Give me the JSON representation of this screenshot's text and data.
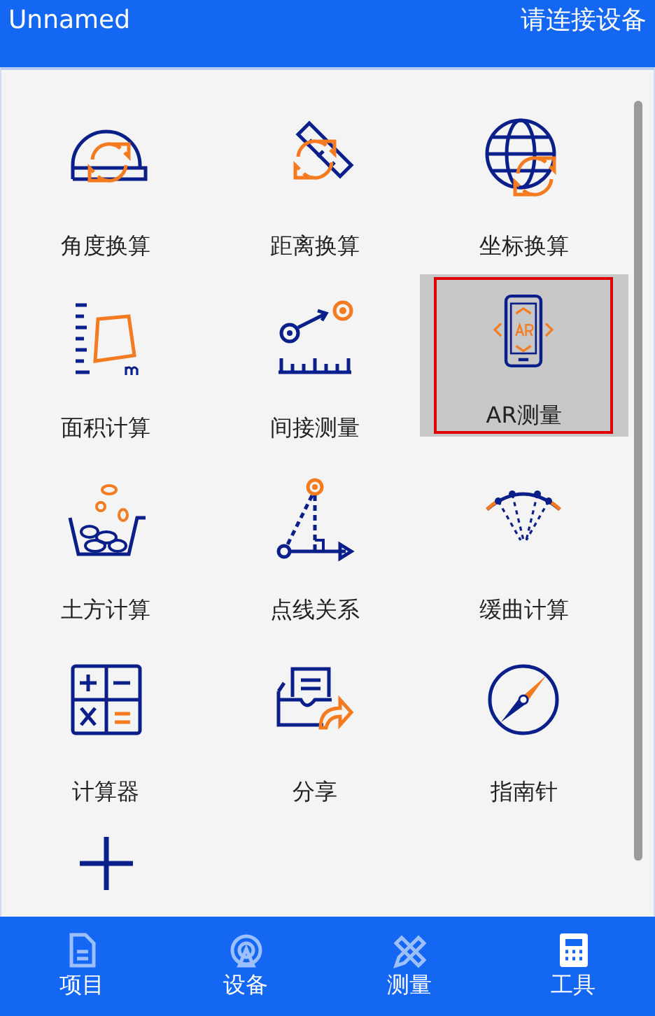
{
  "header": {
    "project": "Unnamed",
    "connection": "请连接设备"
  },
  "tools": [
    {
      "kind": "angle",
      "label": "角度换算",
      "selected": false
    },
    {
      "kind": "distance",
      "label": "距离换算",
      "selected": false
    },
    {
      "kind": "coordinate",
      "label": "坐标换算",
      "selected": false
    },
    {
      "kind": "area",
      "label": "面积计算",
      "selected": false
    },
    {
      "kind": "indirect",
      "label": "间接测量",
      "selected": false
    },
    {
      "kind": "ar",
      "label": "AR测量",
      "selected": true
    },
    {
      "kind": "earthwork",
      "label": "土方计算",
      "selected": false
    },
    {
      "kind": "pointline",
      "label": "点线关系",
      "selected": false
    },
    {
      "kind": "curve",
      "label": "缓曲计算",
      "selected": false
    },
    {
      "kind": "calculator",
      "label": "计算器",
      "selected": false
    },
    {
      "kind": "share",
      "label": "分享",
      "selected": false
    },
    {
      "kind": "compass",
      "label": "指南针",
      "selected": false
    }
  ],
  "tabs": [
    {
      "kind": "project",
      "label": "项目",
      "selected": false
    },
    {
      "kind": "device",
      "label": "设备",
      "selected": false
    },
    {
      "kind": "measure",
      "label": "测量",
      "selected": false
    },
    {
      "kind": "tools",
      "label": "工具",
      "selected": true
    }
  ]
}
